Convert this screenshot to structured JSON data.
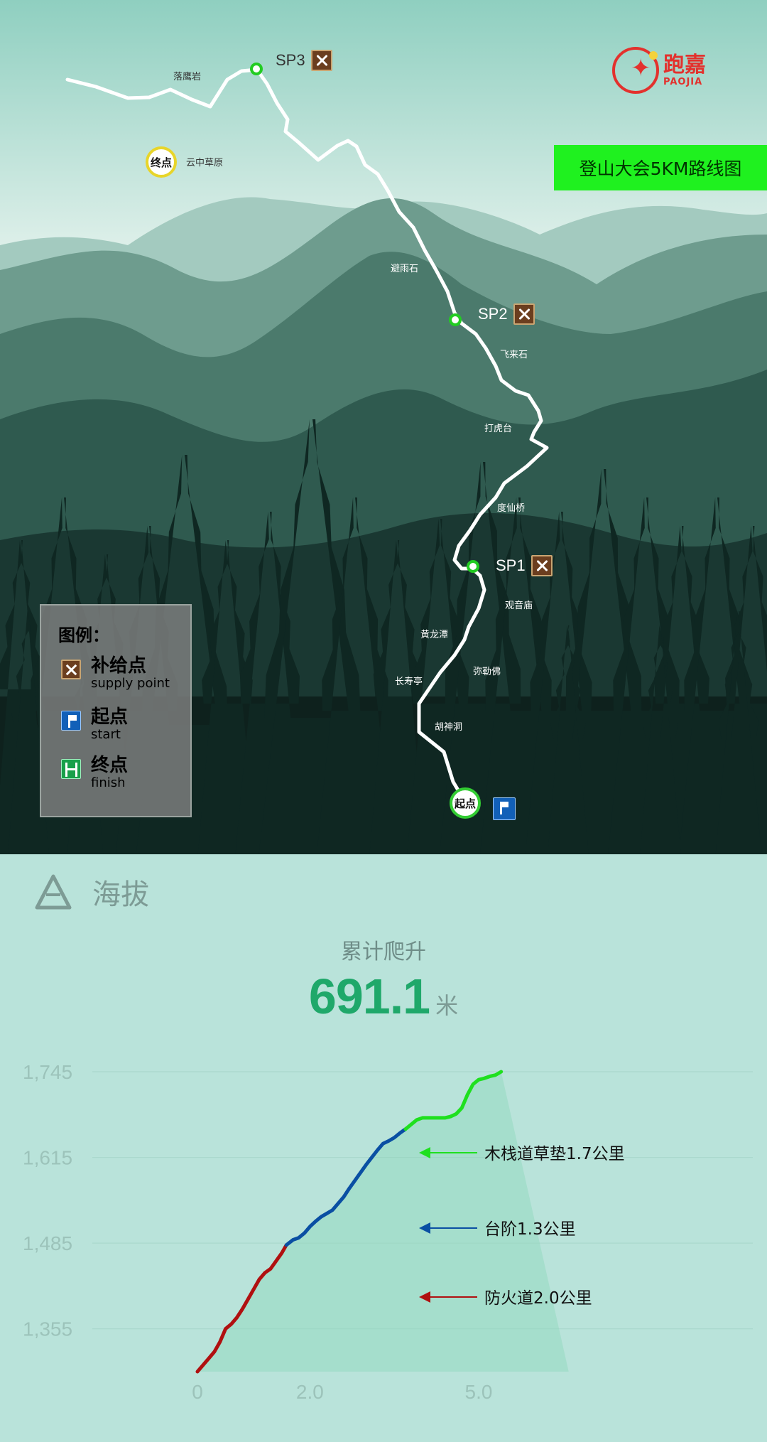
{
  "map": {
    "title": "登山大会5KM路线图",
    "logo": {
      "cn": "跑嘉",
      "en": "PAOJIA"
    },
    "start_label": "起点",
    "finish_label": "终点",
    "supply_points": [
      "SP1",
      "SP2",
      "SP3"
    ],
    "places": [
      "落鹰岩",
      "云中草原",
      "避雨石",
      "飞来石",
      "打虎台",
      "度仙桥",
      "观音庙",
      "黄龙潭",
      "弥勒佛",
      "长寿亭",
      "胡神洞"
    ],
    "legend": {
      "title": "图例：",
      "items": [
        {
          "cn": "补给点",
          "en": "supply point",
          "icon": "supply-icon"
        },
        {
          "cn": "起点",
          "en": "start",
          "icon": "start-flag-icon"
        },
        {
          "cn": "终点",
          "en": "finish",
          "icon": "finish-gate-icon"
        }
      ]
    }
  },
  "elevation": {
    "header": "海拔",
    "summary_label": "累计爬升",
    "summary_value": "691.1",
    "summary_unit": "米"
  },
  "chart_data": {
    "type": "line",
    "title": "",
    "xlabel": "",
    "ylabel": "",
    "ylim": [
      1290,
      1745
    ],
    "xlim": [
      0,
      10
    ],
    "y_ticks": [
      "1,745",
      "1,615",
      "1,485",
      "1,355"
    ],
    "y_tick_values": [
      1745,
      1615,
      1485,
      1355
    ],
    "x_ticks": [
      "0",
      "2.0",
      "5.0"
    ],
    "x_tick_values": [
      0,
      2.0,
      5.0
    ],
    "series": [
      {
        "name": "防火道2.0公里",
        "color": "#b01010",
        "x": [
          0.0,
          0.1,
          0.2,
          0.3,
          0.4,
          0.5,
          0.6,
          0.7,
          0.8,
          0.9,
          1.0,
          1.1,
          1.2,
          1.3,
          1.4,
          1.5,
          1.58
        ],
        "y": [
          1290,
          1300,
          1310,
          1320,
          1335,
          1355,
          1362,
          1372,
          1385,
          1400,
          1415,
          1430,
          1440,
          1446,
          1458,
          1470,
          1482
        ]
      },
      {
        "name": "台阶1.3公里",
        "color": "#0a4fa3",
        "x": [
          1.58,
          1.7,
          1.8,
          1.9,
          2.0,
          2.1,
          2.2,
          2.3,
          2.4,
          2.5,
          2.6,
          2.7,
          2.8,
          2.9,
          3.0,
          3.1,
          3.2,
          3.3,
          3.4,
          3.5,
          3.6,
          3.7
        ],
        "y": [
          1482,
          1490,
          1493,
          1500,
          1510,
          1518,
          1525,
          1530,
          1535,
          1545,
          1555,
          1568,
          1580,
          1592,
          1604,
          1615,
          1626,
          1636,
          1640,
          1645,
          1652,
          1658
        ]
      },
      {
        "name": "木栈道草垫1.7公里",
        "color": "#1fe01f",
        "x": [
          3.7,
          3.8,
          3.9,
          4.0,
          4.1,
          4.2,
          4.3,
          4.4,
          4.5,
          4.6,
          4.7,
          4.8,
          4.9,
          5.0,
          5.1,
          5.2,
          5.3,
          5.4
        ],
        "y": [
          1658,
          1665,
          1672,
          1675,
          1675,
          1675,
          1675,
          1675,
          1677,
          1681,
          1690,
          1710,
          1726,
          1733,
          1735,
          1738,
          1740,
          1745
        ]
      }
    ],
    "legend": "right"
  }
}
